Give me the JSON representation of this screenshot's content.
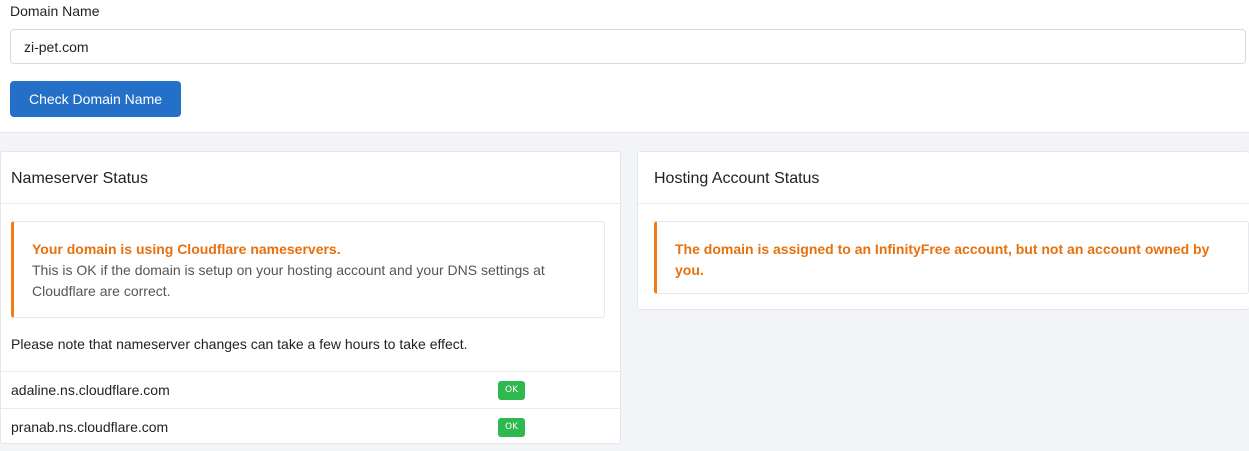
{
  "domain_form": {
    "label": "Domain Name",
    "input_value": "zi-pet.com",
    "button_label": "Check Domain Name"
  },
  "nameserver_panel": {
    "title": "Nameserver Status",
    "alert_title": "Your domain is using Cloudflare nameservers.",
    "alert_text": "This is OK if the domain is setup on your hosting account and your DNS settings at Cloudflare are correct.",
    "note": "Please note that nameserver changes can take a few hours to take effect.",
    "nameservers": [
      {
        "name": "adaline.ns.cloudflare.com",
        "status": "OK"
      },
      {
        "name": "pranab.ns.cloudflare.com",
        "status": "OK"
      }
    ]
  },
  "hosting_panel": {
    "title": "Hosting Account Status",
    "alert_title": "The domain is assigned to an InfinityFree account, but not an account owned by you."
  },
  "colors": {
    "primary_button": "#2470c9",
    "warning_accent": "#f07c13",
    "ok_badge": "#2db94d"
  }
}
